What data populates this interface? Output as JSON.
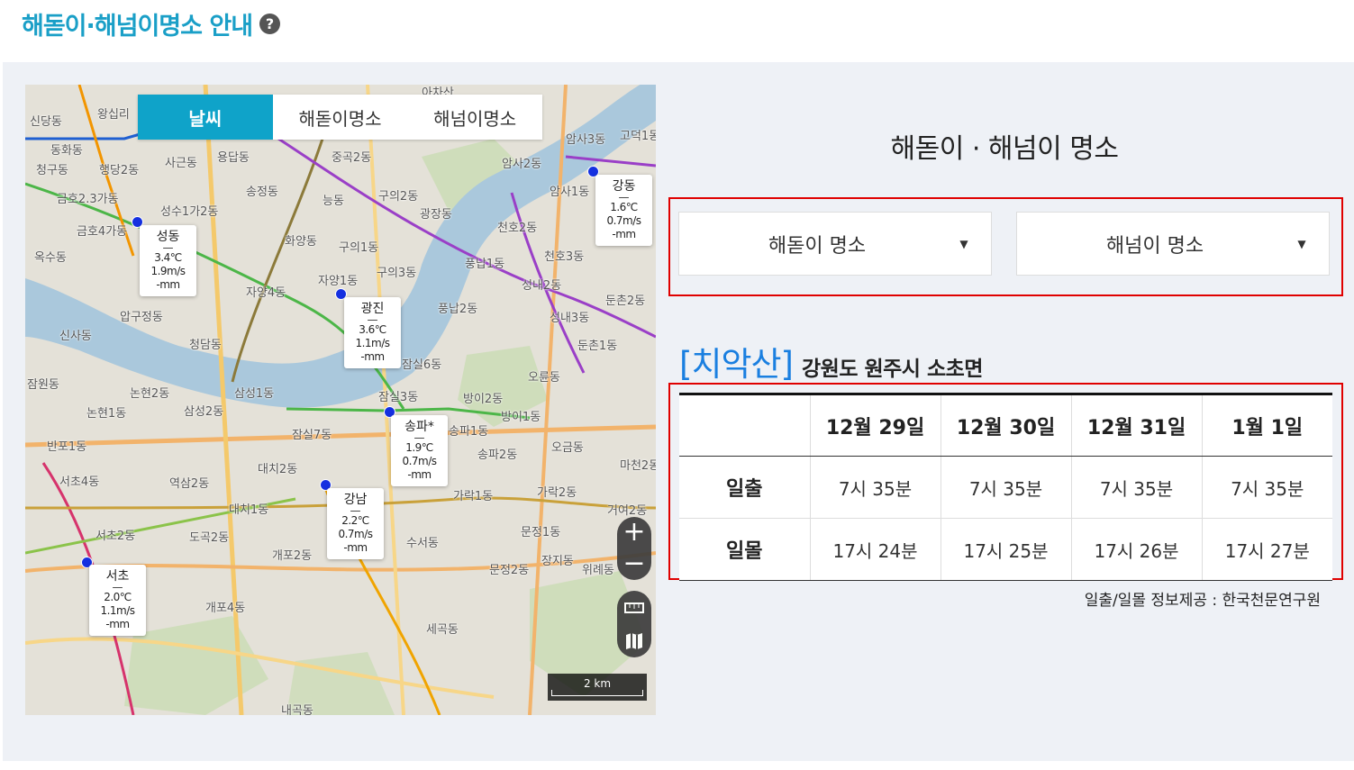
{
  "page": {
    "title": "해돋이·해넘이명소 안내",
    "help_icon": "?"
  },
  "map": {
    "tabs": [
      {
        "label": "날씨",
        "active": true
      },
      {
        "label": "해돋이명소",
        "active": false
      },
      {
        "label": "해넘이명소",
        "active": false
      }
    ],
    "stations": [
      {
        "name": "성동",
        "temp": "3.4℃",
        "wind": "1.9m/s",
        "rain": "-mm"
      },
      {
        "name": "광진",
        "temp": "3.6℃",
        "wind": "1.1m/s",
        "rain": "-mm"
      },
      {
        "name": "강동",
        "temp": "1.6℃",
        "wind": "0.7m/s",
        "rain": "-mm"
      },
      {
        "name": "송파*",
        "temp": "1.9℃",
        "wind": "0.7m/s",
        "rain": "-mm"
      },
      {
        "name": "강남",
        "temp": "2.2℃",
        "wind": "0.7m/s",
        "rain": "-mm"
      },
      {
        "name": "서초",
        "temp": "2.0℃",
        "wind": "1.1m/s",
        "rain": "-mm"
      }
    ],
    "place_labels": [
      "신당동",
      "왕십리",
      "동화동",
      "청구동",
      "행당2동",
      "사근동",
      "용답동",
      "금호2.3가동",
      "성수1가2동",
      "금호4가동",
      "옥수동",
      "송정동",
      "능동",
      "구의2동",
      "광장동",
      "화양동",
      "구의1동",
      "자양1동",
      "구의3동",
      "자양4동",
      "압구정동",
      "신사동",
      "청담동",
      "논현2동",
      "논현1동",
      "삼성1동",
      "삼성2동",
      "잠원동",
      "반포1동",
      "서초4동",
      "역삼2동",
      "대치2동",
      "대치1동",
      "도곡2동",
      "서초2동",
      "개포2동",
      "개포4동",
      "세곡동",
      "수서동",
      "장지동",
      "문정1동",
      "문정2동",
      "가락1동",
      "가락2동",
      "송파1동",
      "송파2동",
      "방이1동",
      "방이2동",
      "오금동",
      "마천2동",
      "거여2동",
      "잠실6동",
      "잠실3동",
      "잠실7동",
      "풍납1동",
      "풍납2동",
      "성내2동",
      "성내3동",
      "둔촌1동",
      "둔촌2동",
      "오륜동",
      "천호2동",
      "천호3동",
      "암사1동",
      "암사2동",
      "암사3동",
      "고덕1동",
      "내곡동",
      "중곡2동",
      "아차산",
      "위례동"
    ],
    "zoom_in": "+",
    "zoom_out": "−",
    "scale": "2 km"
  },
  "right": {
    "title": "해돋이 · 해넘이 명소",
    "sunrise_select": "해돋이 명소",
    "sunset_select": "해넘이 명소",
    "place_name": "[치악산]",
    "place_address": "강원도 원주시 소초면",
    "table": {
      "columns": [
        "12월 29일",
        "12월 30일",
        "12월 31일",
        "1월 1일"
      ],
      "rows": [
        {
          "label": "일출",
          "values": [
            "7시 35분",
            "7시 35분",
            "7시 35분",
            "7시 35분"
          ]
        },
        {
          "label": "일몰",
          "values": [
            "17시 24분",
            "17시 25분",
            "17시 26분",
            "17시 27분"
          ]
        }
      ]
    },
    "source": "일출/일몰 정보제공 : 한국천문연구원"
  }
}
